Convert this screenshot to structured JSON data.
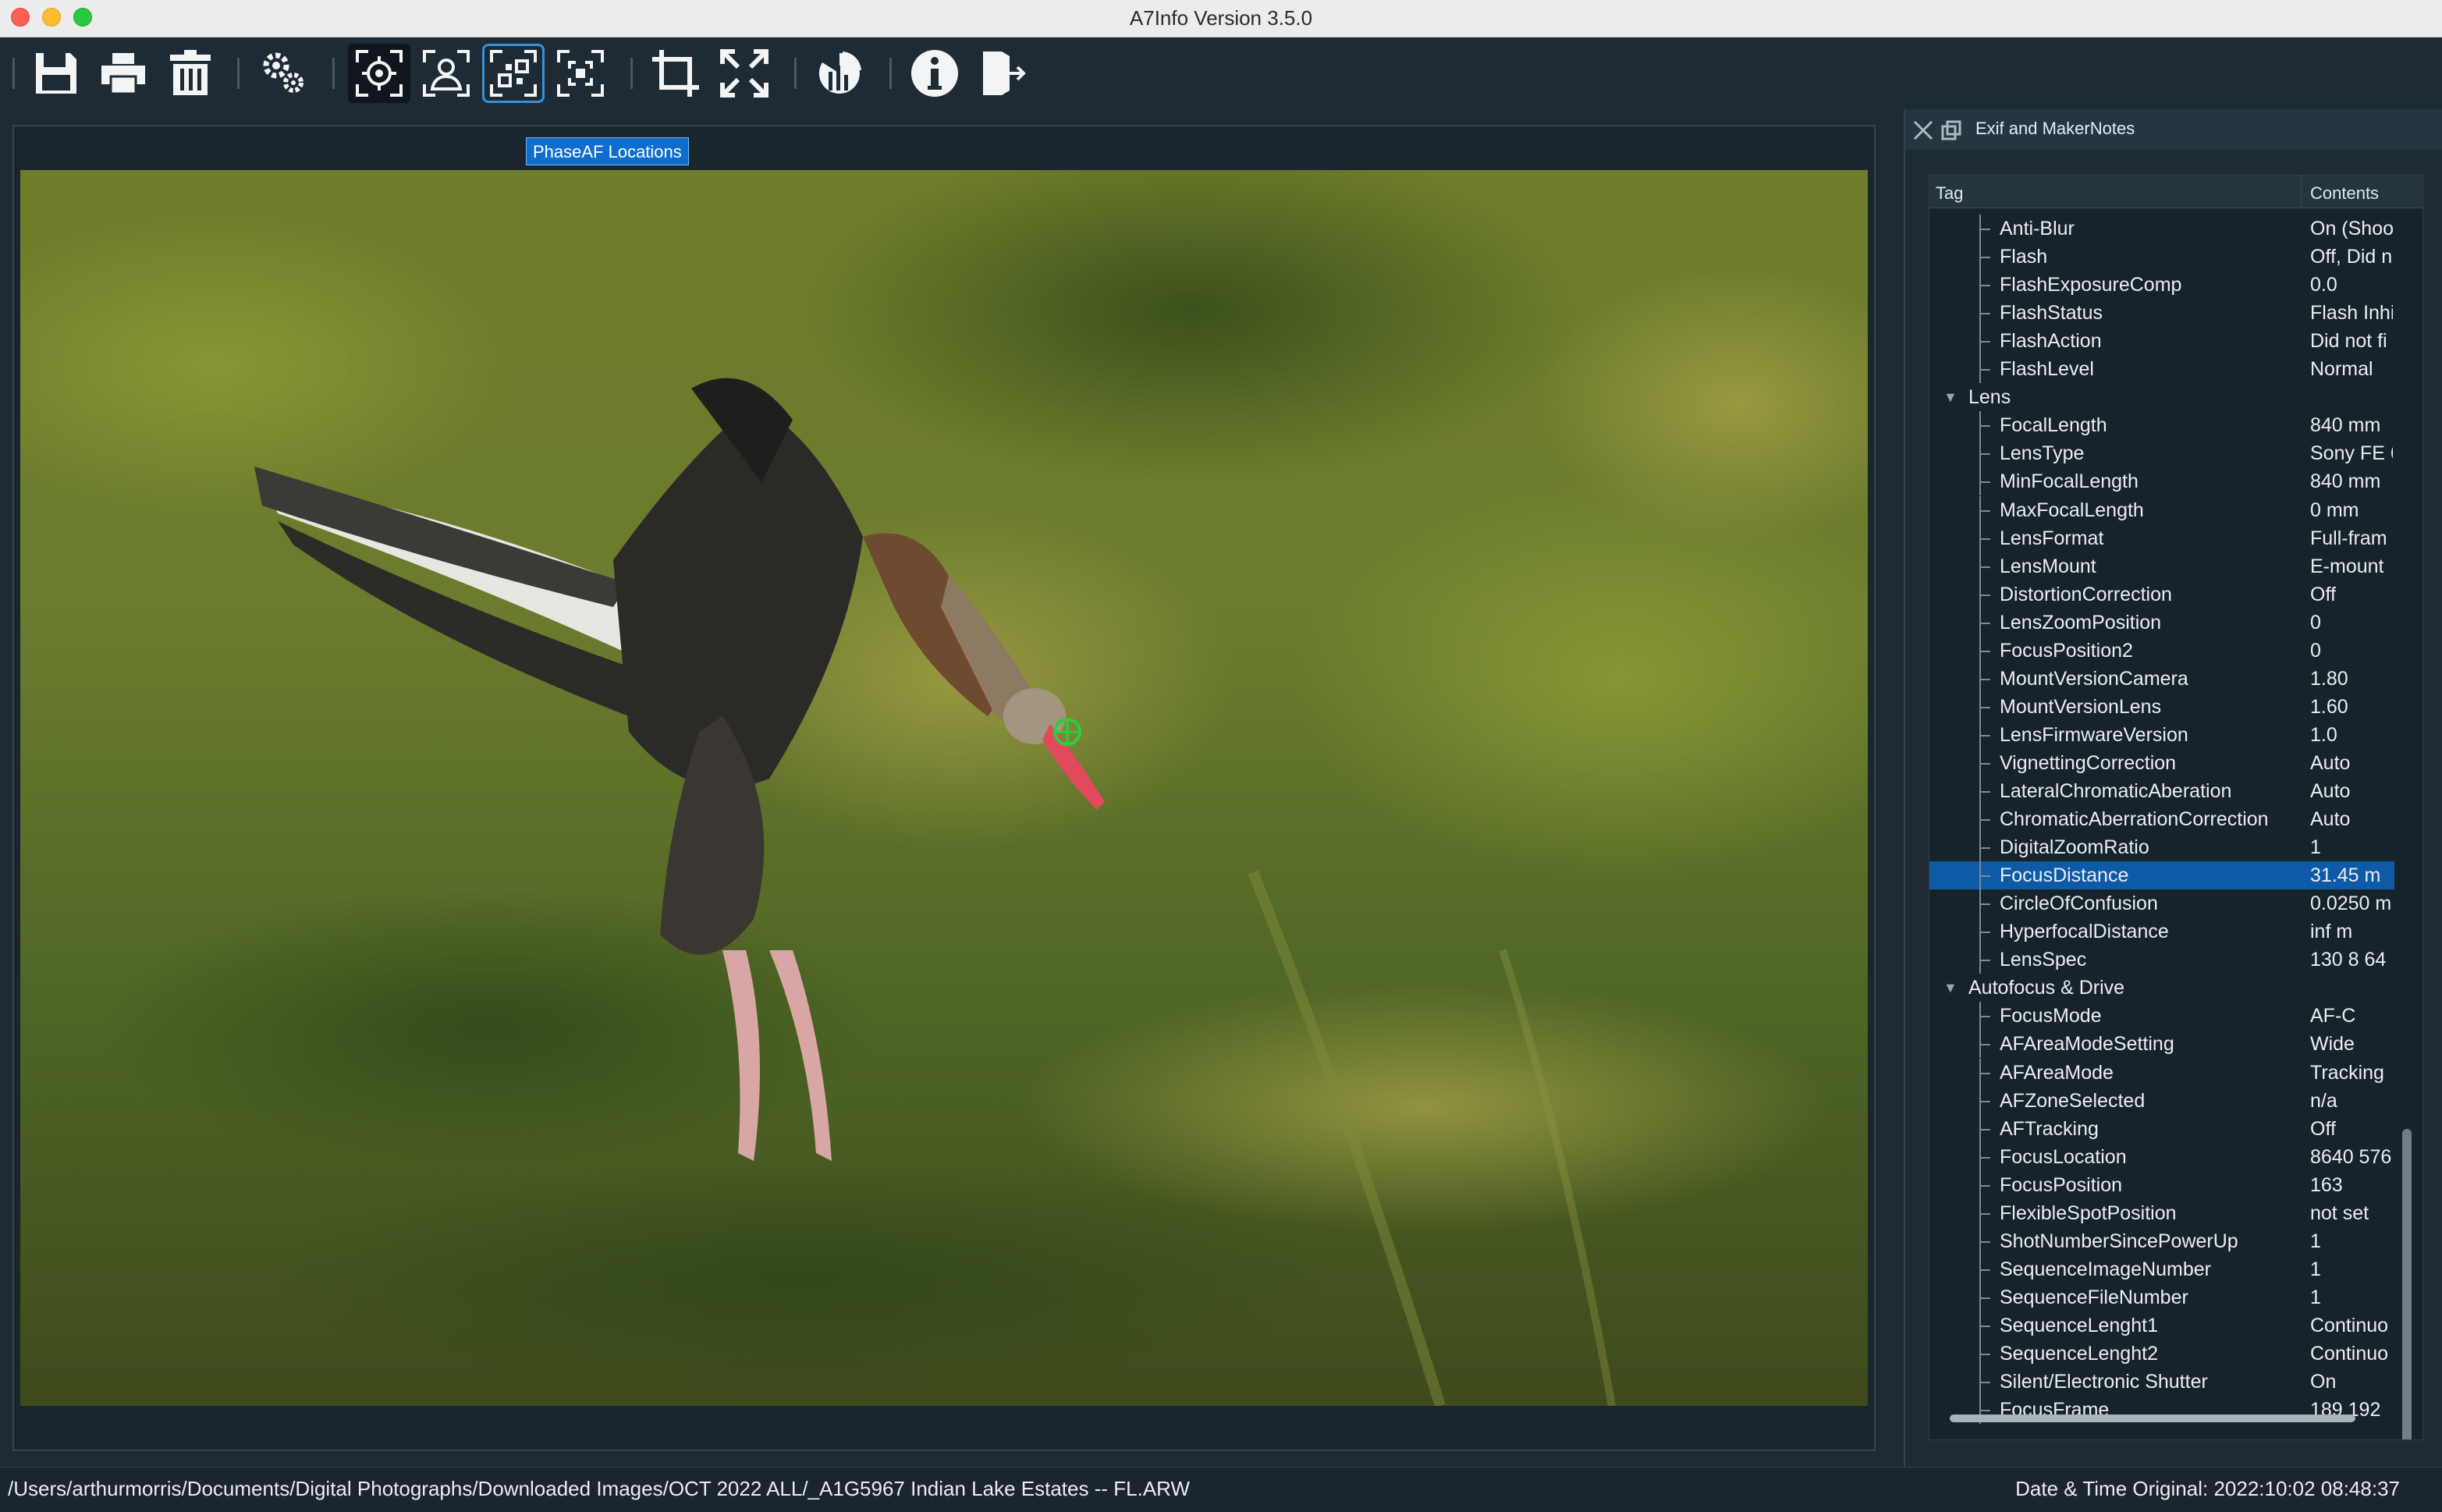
{
  "window": {
    "title": "A7Info Version 3.5.0"
  },
  "toolbar": {
    "buttons": [
      {
        "icon": "save-icon"
      },
      {
        "icon": "print-icon"
      },
      {
        "icon": "trash-icon"
      },
      {
        "icon": "settings-icon"
      },
      {
        "icon": "focus-point-icon"
      },
      {
        "icon": "face-detect-icon"
      },
      {
        "icon": "phase-af-icon"
      },
      {
        "icon": "focus-frame-icon"
      },
      {
        "icon": "crop-icon"
      },
      {
        "icon": "fullscreen-icon"
      },
      {
        "icon": "statistics-icon"
      },
      {
        "icon": "info-icon"
      },
      {
        "icon": "exit-icon"
      }
    ]
  },
  "viewer": {
    "tab_label": "PhaseAF Locations"
  },
  "panel": {
    "title": "Exif and MakerNotes",
    "columns": {
      "tag": "Tag",
      "contents": "Contents"
    },
    "rows": [
      {
        "tag": "Anti-Blur",
        "value": "On (Shoo"
      },
      {
        "tag": "Flash",
        "value": "Off, Did n"
      },
      {
        "tag": "FlashExposureComp",
        "value": "0.0"
      },
      {
        "tag": "FlashStatus",
        "value": "Flash Inhi"
      },
      {
        "tag": "FlashAction",
        "value": "Did not fi"
      },
      {
        "tag": "FlashLevel",
        "value": "Normal"
      },
      {
        "tag": "Lens",
        "value": "",
        "group": true
      },
      {
        "tag": "FocalLength",
        "value": "840 mm"
      },
      {
        "tag": "LensType",
        "value": "Sony FE 6"
      },
      {
        "tag": "MinFocalLength",
        "value": "840 mm"
      },
      {
        "tag": "MaxFocalLength",
        "value": "0 mm"
      },
      {
        "tag": "LensFormat",
        "value": "Full-fram"
      },
      {
        "tag": "LensMount",
        "value": "E-mount"
      },
      {
        "tag": "DistortionCorrection",
        "value": "Off"
      },
      {
        "tag": "LensZoomPosition",
        "value": "0"
      },
      {
        "tag": "FocusPosition2",
        "value": "0"
      },
      {
        "tag": "MountVersionCamera",
        "value": "1.80"
      },
      {
        "tag": "MountVersionLens",
        "value": "1.60"
      },
      {
        "tag": "LensFirmwareVersion",
        "value": "1.0"
      },
      {
        "tag": "VignettingCorrection",
        "value": "Auto"
      },
      {
        "tag": "LateralChromaticAberation",
        "value": "Auto"
      },
      {
        "tag": "ChromaticAberrationCorrection",
        "value": "Auto"
      },
      {
        "tag": "DigitalZoomRatio",
        "value": "1"
      },
      {
        "tag": "FocusDistance",
        "value": "31.45 m",
        "selected": true
      },
      {
        "tag": "CircleOfConfusion",
        "value": "0.0250 m"
      },
      {
        "tag": "HyperfocalDistance",
        "value": "inf m"
      },
      {
        "tag": "LensSpec",
        "value": "130 8 64"
      },
      {
        "tag": "Autofocus & Drive",
        "value": "",
        "group": true
      },
      {
        "tag": "FocusMode",
        "value": "AF-C"
      },
      {
        "tag": "AFAreaModeSetting",
        "value": "Wide"
      },
      {
        "tag": "AFAreaMode",
        "value": "Tracking"
      },
      {
        "tag": "AFZoneSelected",
        "value": "n/a"
      },
      {
        "tag": "AFTracking",
        "value": "Off"
      },
      {
        "tag": "FocusLocation",
        "value": "8640 576"
      },
      {
        "tag": "FocusPosition",
        "value": "163"
      },
      {
        "tag": "FlexibleSpotPosition",
        "value": "not set"
      },
      {
        "tag": "ShotNumberSincePowerUp",
        "value": "1"
      },
      {
        "tag": "SequenceImageNumber",
        "value": "1"
      },
      {
        "tag": "SequenceFileNumber",
        "value": "1"
      },
      {
        "tag": "SequenceLenght1",
        "value": "Continuo"
      },
      {
        "tag": "SequenceLenght2",
        "value": "Continuo"
      },
      {
        "tag": "Silent/Electronic Shutter",
        "value": "On"
      },
      {
        "tag": "FocusFrame",
        "value": "189 192"
      }
    ]
  },
  "status": {
    "path": "/Users/arthurmorris/Documents/Digital Photographs/Downloaded Images/OCT 2022 ALL/_A1G5967  Indian Lake Estates -- FL.ARW",
    "date": "Date & Time Original: 2022:10:02 08:48:37"
  },
  "colors": {
    "accent": "#0d6ecf",
    "selection": "#0f5aa6",
    "background": "#1e2b34",
    "focus_marker": "#27d13a"
  }
}
